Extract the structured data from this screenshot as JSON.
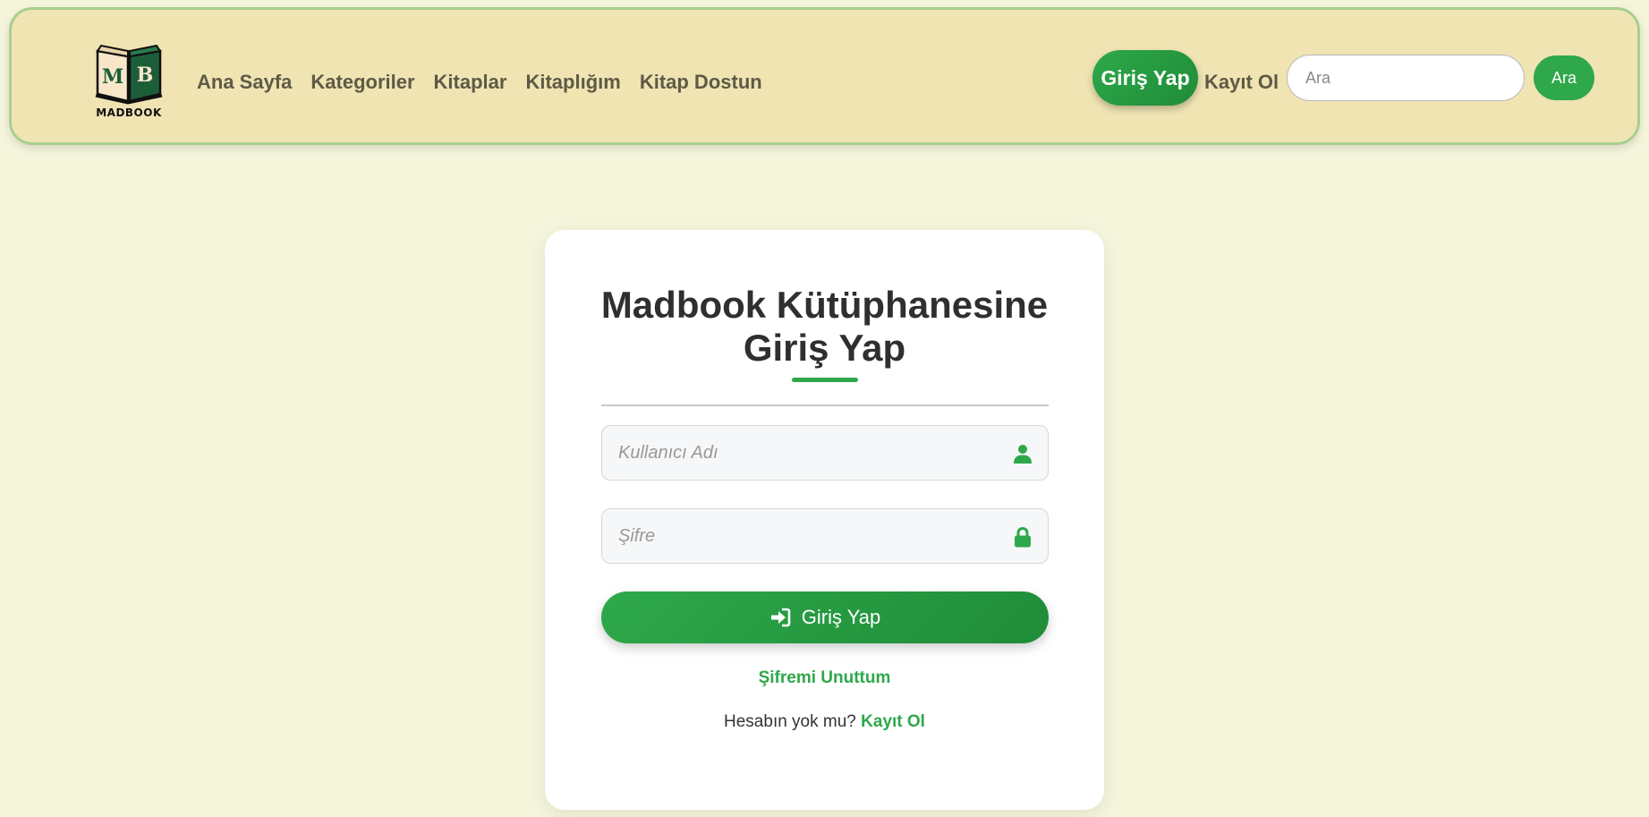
{
  "header": {
    "logo_text": "MADBOOK",
    "logo_letters": [
      "M",
      "B"
    ],
    "nav": [
      {
        "label": "Ana Sayfa"
      },
      {
        "label": "Kategoriler"
      },
      {
        "label": "Kitaplar"
      },
      {
        "label": "Kitaplığım"
      },
      {
        "label": "Kitap Dostun"
      }
    ],
    "login_label": "Giriş Yap",
    "register_label": "Kayıt Ol",
    "search_placeholder": "Ara",
    "search_button": "Ara"
  },
  "login_card": {
    "title_line1": "Madbook Kütüphanesine",
    "title_line2": "Giriş Yap",
    "username_placeholder": "Kullanıcı Adı",
    "password_placeholder": "Şifre",
    "submit_label": "Giriş Yap",
    "forgot_label": "Şifremi Unuttum",
    "no_account_text": "Hesabın yok mu?",
    "register_link": "Kayıt Ol"
  },
  "colors": {
    "accent": "#2ea84a",
    "page_background": "#f5f5dc",
    "header_background": "#f0e4b3",
    "header_border": "#a8cf8e"
  },
  "icons": {
    "logo": "book-logo-icon",
    "username": "user-icon",
    "password": "lock-icon",
    "submit": "sign-in-icon"
  }
}
